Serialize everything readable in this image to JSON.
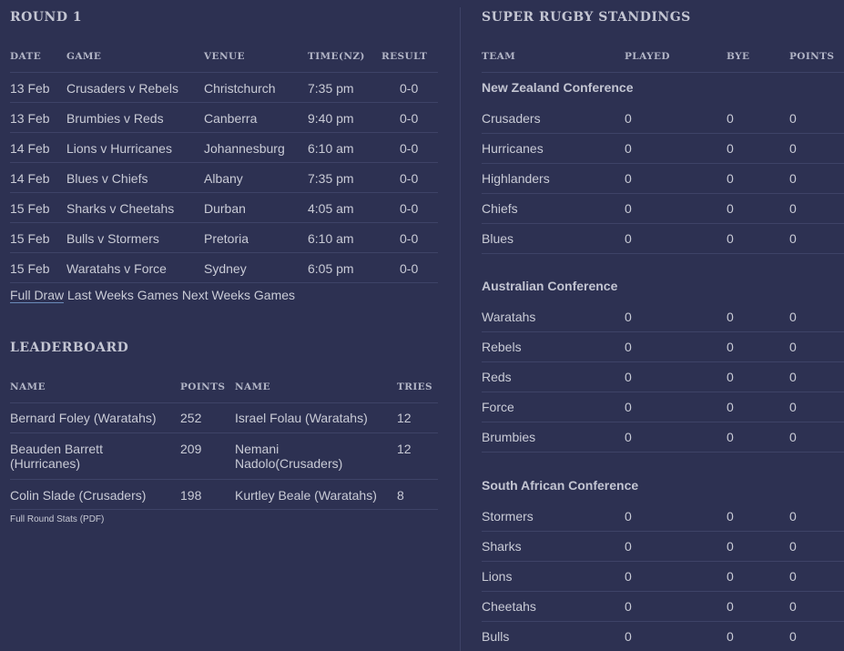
{
  "round": {
    "title": "ROUND 1",
    "headers": {
      "date": "DATE",
      "game": "GAME",
      "venue": "VENUE",
      "time": "TIME(NZ)",
      "result": "RESULT"
    },
    "games": [
      {
        "date": "13 Feb",
        "game": "Crusaders v Rebels",
        "venue": "Christchurch",
        "time": "7:35 pm",
        "result": "0-0"
      },
      {
        "date": "13 Feb",
        "game": "Brumbies v Reds",
        "venue": "Canberra",
        "time": "9:40 pm",
        "result": "0-0"
      },
      {
        "date": "14 Feb",
        "game": "Lions v Hurricanes",
        "venue": "Johannesburg",
        "time": "6:10 am",
        "result": "0-0"
      },
      {
        "date": "14 Feb",
        "game": "Blues v Chiefs",
        "venue": "Albany",
        "time": "7:35 pm",
        "result": "0-0"
      },
      {
        "date": "15 Feb",
        "game": "Sharks v Cheetahs",
        "venue": "Durban",
        "time": "4:05 am",
        "result": "0-0"
      },
      {
        "date": "15 Feb",
        "game": "Bulls v Stormers",
        "venue": "Pretoria",
        "time": "6:10 am",
        "result": "0-0"
      },
      {
        "date": "15 Feb",
        "game": "Waratahs v Force",
        "venue": "Sydney",
        "time": "6:05 pm",
        "result": "0-0"
      }
    ],
    "links": {
      "full_draw": "Full Draw",
      "last_weeks": "Last Weeks Games",
      "next_weeks": "Next Weeks Games"
    }
  },
  "leaderboard": {
    "title": "LEADERBOARD",
    "headers": {
      "name1": "NAME",
      "points": "POINTS",
      "name2": "NAME",
      "tries": "TRIES"
    },
    "rows": [
      {
        "name1": "Bernard Foley (Waratahs)",
        "points": "252",
        "name2": "Israel Folau (Waratahs)",
        "tries": "12"
      },
      {
        "name1a": "Beauden Barrett",
        "name1b": "(Hurricanes)",
        "points": "209",
        "name2a": "Nemani",
        "name2b": "Nadolo(Crusaders)",
        "tries": "12"
      },
      {
        "name1": "Colin Slade (Crusaders)",
        "points": "198",
        "name2": "Kurtley Beale (Waratahs)",
        "tries": "8"
      }
    ],
    "stats_link": "Full Round Stats (PDF)"
  },
  "standings": {
    "title": "SUPER RUGBY STANDINGS",
    "headers": {
      "team": "TEAM",
      "played": "PLAYED",
      "bye": "BYE",
      "points": "POINTS"
    },
    "conferences": [
      {
        "name": "New Zealand Conference",
        "teams": [
          {
            "team": "Crusaders",
            "played": "0",
            "bye": "0",
            "points": "0"
          },
          {
            "team": "Hurricanes",
            "played": "0",
            "bye": "0",
            "points": "0"
          },
          {
            "team": "Highlanders",
            "played": "0",
            "bye": "0",
            "points": "0"
          },
          {
            "team": "Chiefs",
            "played": "0",
            "bye": "0",
            "points": "0"
          },
          {
            "team": "Blues",
            "played": "0",
            "bye": "0",
            "points": "0"
          }
        ]
      },
      {
        "name": "Australian Conference",
        "teams": [
          {
            "team": "Waratahs",
            "played": "0",
            "bye": "0",
            "points": "0"
          },
          {
            "team": "Rebels",
            "played": "0",
            "bye": "0",
            "points": "0"
          },
          {
            "team": "Reds",
            "played": "0",
            "bye": "0",
            "points": "0"
          },
          {
            "team": "Force",
            "played": "0",
            "bye": "0",
            "points": "0"
          },
          {
            "team": "Brumbies",
            "played": "0",
            "bye": "0",
            "points": "0"
          }
        ]
      },
      {
        "name": "South African Conference",
        "teams": [
          {
            "team": "Stormers",
            "played": "0",
            "bye": "0",
            "points": "0"
          },
          {
            "team": "Sharks",
            "played": "0",
            "bye": "0",
            "points": "0"
          },
          {
            "team": "Lions",
            "played": "0",
            "bye": "0",
            "points": "0"
          },
          {
            "team": "Cheetahs",
            "played": "0",
            "bye": "0",
            "points": "0"
          },
          {
            "team": "Bulls",
            "played": "0",
            "bye": "0",
            "points": "0"
          }
        ]
      }
    ]
  },
  "colors": {
    "background": "#2d3152",
    "text": "#c9cbd6",
    "divider": "#3e4367",
    "link_underline": "#6a8ab8"
  }
}
